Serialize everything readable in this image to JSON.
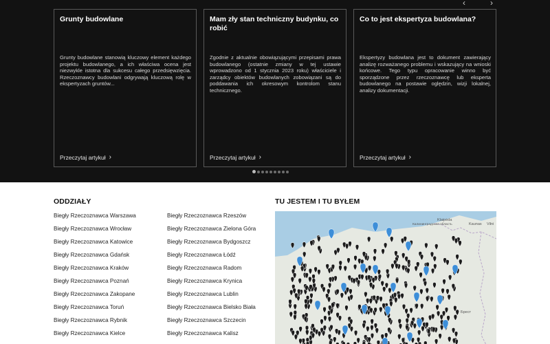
{
  "carousel": {
    "prev_icon": "chevron-left-icon",
    "next_icon": "chevron-right-icon",
    "cards": [
      {
        "title": "Grunty budowlane",
        "excerpt": "Grunty budowlane stanowią kluczowy element każdego projektu budowlanego, a ich właściwa ocena jest niezwykle istotna dla sukcesu całego przedsięwzięcia. Rzeczoznawcy budowlani odgrywają kluczową rolę w ekspertyzach gruntów...",
        "link_label": "Przeczytaj artykuł"
      },
      {
        "title": "Mam zły stan techniczny budynku, co robić",
        "excerpt": "Zgodnie z aktualnie obowiązującymi przepisami prawa budowlanego (ostatnie zmiany w tej ustawie wprowadzono od 1 stycznia 2023 roku) właściciele i zarządcy obiektów budowlanych zobowiązani są do poddawania ich okresowym kontrolom stanu technicznego.",
        "link_label": "Przeczytaj artykuł"
      },
      {
        "title": "Co to jest ekspertyza budowlana?",
        "excerpt": "Ekspertyzy budowlana jest to dokument zawierający analizę rozważanego problemu i wskazujący na wnioski końcowe. Tego typu opracowanie winno być sporządzone przez rzeczoznawcę lub eksperta budowlanego na postawie oględzin, wizji lokalnej, analizy dokumentacji.",
        "link_label": "Przeczytaj artykuł"
      }
    ],
    "page_count": 9,
    "active_page": 1
  },
  "branches": {
    "heading": "ODDZIAŁY",
    "col1": [
      "Biegły Rzeczoznawca Warszawa",
      "Biegły Rzeczoznawca Wrocław",
      "Biegły Rzeczoznawca Katowice",
      "Biegły Rzeczoznawca Gdańsk",
      "Biegły Rzeczoznawca Kraków",
      "Biegły Rzeczoznawca Poznań",
      "Biegły Rzeczoznawca Zakopane",
      "Biegły Rzeczoznawca Toruń",
      "Biegły Rzeczoznawca Rybnik",
      "Biegły Rzeczoznawca Kielce"
    ],
    "col2": [
      "Biegły Rzeczoznawca Rzeszów",
      "Biegły Rzeczoznawca Zielona Góra",
      "Biegły Rzeczoznawca Bydgoszcz",
      "Biegły Rzeczoznawca Łódź",
      "Biegły Rzeczoznawca Radom",
      "Biegły Rzeczoznawca Krynica",
      "Biegły Rzeczoznawca Lublin",
      "Biegły Rzeczoznawca Bielsko Biała",
      "Biegły Rzeczoznawca Szczecin",
      "Biegły Rzeczoznawca Kalisz"
    ]
  },
  "map": {
    "heading": "TU JESTEM I TU BYŁEM",
    "labels": [
      "Klaipėda",
      "Kaunas",
      "Vilni",
      "Калининградская область",
      "Брест"
    ],
    "colors": {
      "land": "#e6e9e2",
      "water": "#a9cde4",
      "dark_marker": "#1c1c1c",
      "blue_marker": "#3d8ed8"
    }
  }
}
